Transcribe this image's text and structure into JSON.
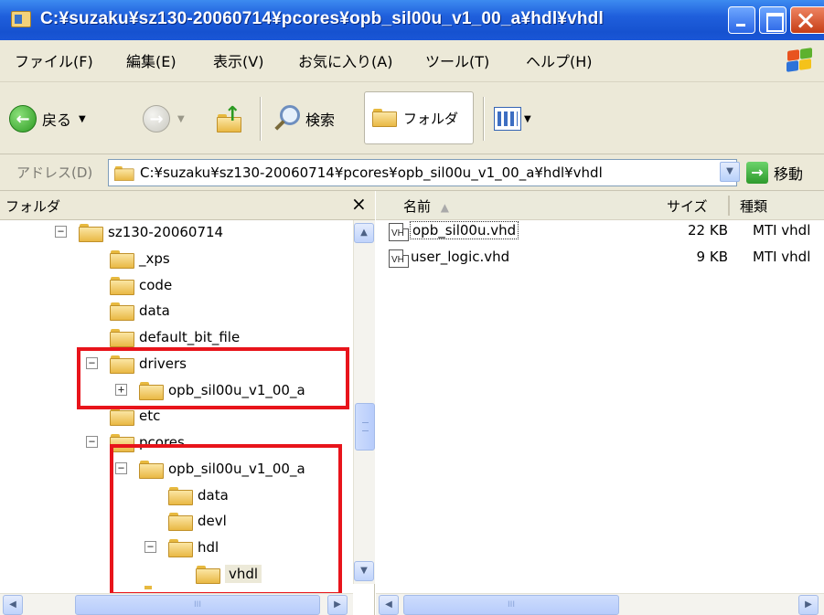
{
  "window": {
    "title": "C:¥suzaku¥sz130-20060714¥pcores¥opb_sil00u_v1_00_a¥hdl¥vhdl"
  },
  "menu": {
    "items": [
      "ファイル(F)",
      "編集(E)",
      "表示(V)",
      "お気に入り(A)",
      "ツール(T)",
      "ヘルプ(H)"
    ]
  },
  "toolbar": {
    "back_label": "戻る",
    "search_label": "検索",
    "folders_label": "フォルダ"
  },
  "address": {
    "label": "アドレス(D)",
    "value": "C:¥suzaku¥sz130-20060714¥pcores¥opb_sil00u_v1_00_a¥hdl¥vhdl",
    "go_label": "移動"
  },
  "folder_pane": {
    "title": "フォルダ",
    "close_glyph": "×",
    "tree": [
      {
        "label": "sz130-20060714",
        "expander": "−"
      },
      {
        "label": "_xps",
        "expander": ""
      },
      {
        "label": "code",
        "expander": ""
      },
      {
        "label": "data",
        "expander": ""
      },
      {
        "label": "default_bit_file",
        "expander": ""
      },
      {
        "label": "drivers",
        "expander": "−"
      },
      {
        "label": "opb_sil00u_v1_00_a",
        "expander": "+"
      },
      {
        "label": "etc",
        "expander": ""
      },
      {
        "label": "pcores",
        "expander": "−"
      },
      {
        "label": "opb_sil00u_v1_00_a",
        "expander": "−"
      },
      {
        "label": "data",
        "expander": ""
      },
      {
        "label": "devl",
        "expander": ""
      },
      {
        "label": "hdl",
        "expander": "−"
      },
      {
        "label": "vhdl",
        "expander": ""
      }
    ]
  },
  "file_list": {
    "columns": {
      "name": "名前",
      "size": "サイズ",
      "type": "種類"
    },
    "rows": [
      {
        "name": "opb_sil00u.vhd",
        "size": "22 KB",
        "type": "MTI vhdl",
        "icon_text": "VH"
      },
      {
        "name": "user_logic.vhd",
        "size": "9 KB",
        "type": "MTI vhdl",
        "icon_text": "VH"
      }
    ]
  },
  "icons": {
    "back": "back-arrow-icon",
    "forward": "forward-arrow-icon",
    "up": "up-folder-icon",
    "search": "search-icon",
    "folders": "folders-icon",
    "views": "views-icon",
    "go": "go-arrow-icon"
  },
  "colors": {
    "titlebar": "#1f5fdc",
    "highlight_box": "#e8141b",
    "chrome": "#ece9d8"
  }
}
